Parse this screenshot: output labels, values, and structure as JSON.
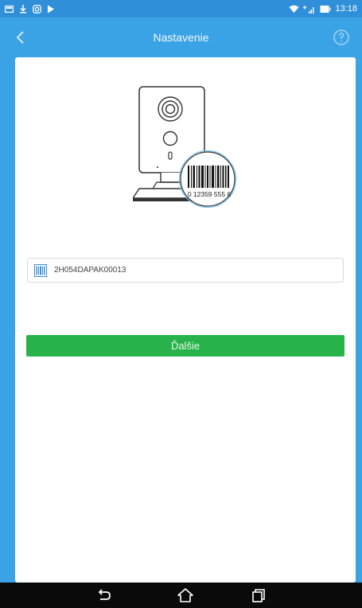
{
  "status_bar": {
    "time": "13:18",
    "icons": [
      "notification-icon",
      "download-icon",
      "instagram-icon",
      "play-store-icon",
      "wifi-icon",
      "signal-icon",
      "battery-icon"
    ]
  },
  "app_bar": {
    "title": "Nastavenie",
    "back_icon": "chevron-left-icon",
    "help_icon": "help-icon"
  },
  "setup": {
    "barcode_sample_text": "0 12359 555 6",
    "serial_field": {
      "value": "2H054DAPAK00013",
      "icon": "barcode-icon"
    },
    "next_button_label": "Ďalšie"
  },
  "colors": {
    "primary": "#3aa3e6",
    "status_bar": "#2f8fd8",
    "button_green": "#27b34a",
    "nav_bar": "#0a0a0a"
  },
  "nav_bar": {
    "icons": [
      "back-icon",
      "home-icon",
      "recents-icon"
    ]
  }
}
